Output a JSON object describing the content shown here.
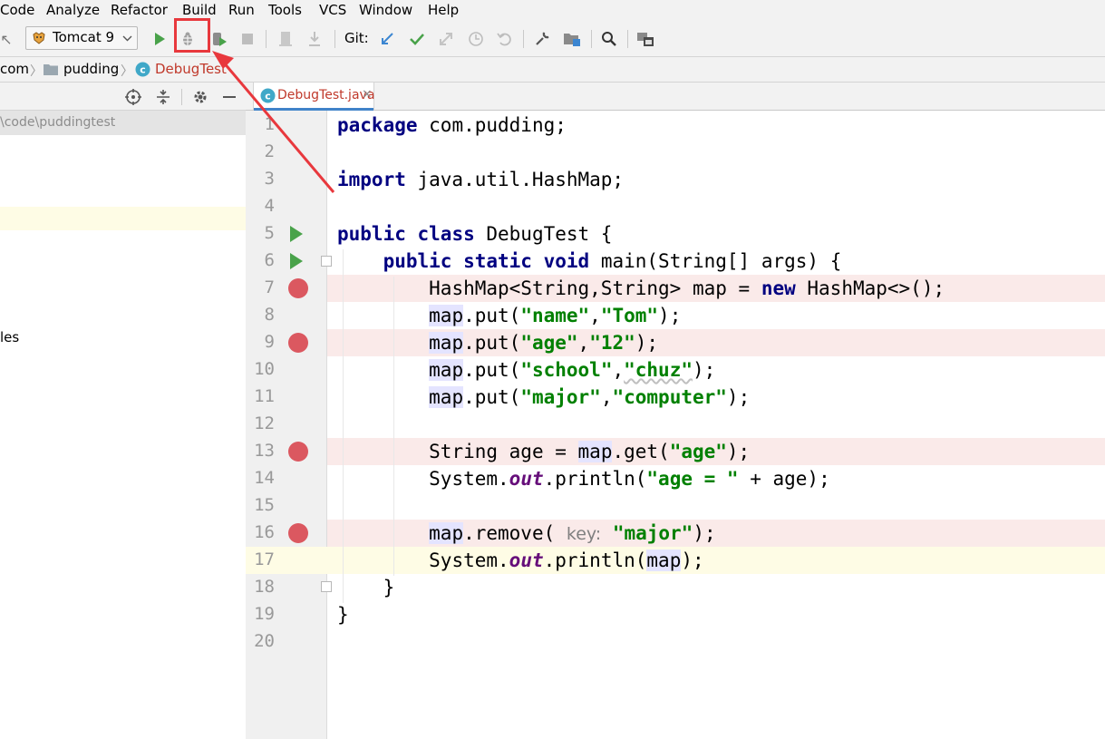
{
  "menu": [
    "Code",
    "Analyze",
    "Refactor",
    "Build",
    "Run",
    "Tools",
    "VCS",
    "Window",
    "Help"
  ],
  "toolbar": {
    "run_config": "Tomcat 9",
    "git_label": "Git:"
  },
  "breadcrumb": [
    "com",
    "pudding",
    "DebugTest"
  ],
  "project": {
    "path": "\\code\\puddingtest",
    "partial_item": "les"
  },
  "editor": {
    "tab_label": "DebugTest.java",
    "line_numbers": [
      "1",
      "2",
      "3",
      "4",
      "5",
      "6",
      "7",
      "8",
      "9",
      "10",
      "11",
      "12",
      "13",
      "14",
      "15",
      "16",
      "17",
      "18",
      "19",
      "20"
    ],
    "lines": {
      "l1_kw": "package",
      "l1_rest": " com.pudding;",
      "l3_kw": "import",
      "l3_rest": " java.util.HashMap;",
      "l5_kw1": "public",
      "l5_kw2": "class",
      "l5_rest": " DebugTest {",
      "l6_kw1": "public",
      "l6_kw2": "static",
      "l6_kw3": "void",
      "l6_rest": " main(String[] args) {",
      "l7_a": "HashMap<String,String> map = ",
      "l7_kw": "new",
      "l7_b": " HashMap<>();",
      "map": "map",
      "put_open": ".put(",
      "comma": ",",
      "close": ");",
      "k_name": "\"name\"",
      "v_name": "\"Tom\"",
      "k_age": "\"age\"",
      "v_age": "\"12\"",
      "k_school": "\"school\"",
      "v_school": "\"chuz\"",
      "k_major": "\"major\"",
      "v_major": "\"computer\"",
      "l13_a": "String age = ",
      "l13_get": ".get(",
      "l13_str": "\"age\"",
      "sys": "System.",
      "out": "out",
      "l14_a": ".println(",
      "l14_str": "\"age = \"",
      "l14_b": " + age);",
      "l16_a": ".remove( ",
      "l16_hint": "key:",
      "l16_str": " \"major\"",
      "l17_a": ".println(",
      "l17_b": ");",
      "brace1": "}",
      "brace2": "}"
    }
  },
  "colors": {
    "breakpoint": "#db5860",
    "breakpoint_line": "#faeae9",
    "current_line": "#fefce5",
    "keyword": "#000080",
    "string": "#008000",
    "annotation_red": "#e8383d"
  }
}
